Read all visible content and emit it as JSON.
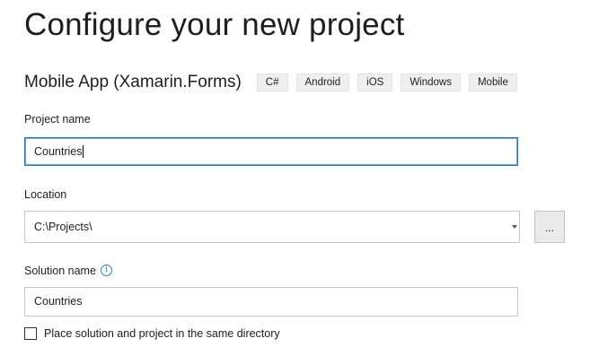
{
  "header": {
    "title": "Configure your new project"
  },
  "template": {
    "name": "Mobile App (Xamarin.Forms)",
    "tags": [
      "C#",
      "Android",
      "iOS",
      "Windows",
      "Mobile"
    ]
  },
  "project_name": {
    "label": "Project name",
    "value": "Countries"
  },
  "location": {
    "label": "Location",
    "value": "C:\\Projects\\",
    "browse_label": "..."
  },
  "solution_name": {
    "label": "Solution name",
    "value": "Countries",
    "info_icon": "info-icon"
  },
  "same_directory": {
    "label": "Place solution and project in the same directory",
    "checked": false
  }
}
